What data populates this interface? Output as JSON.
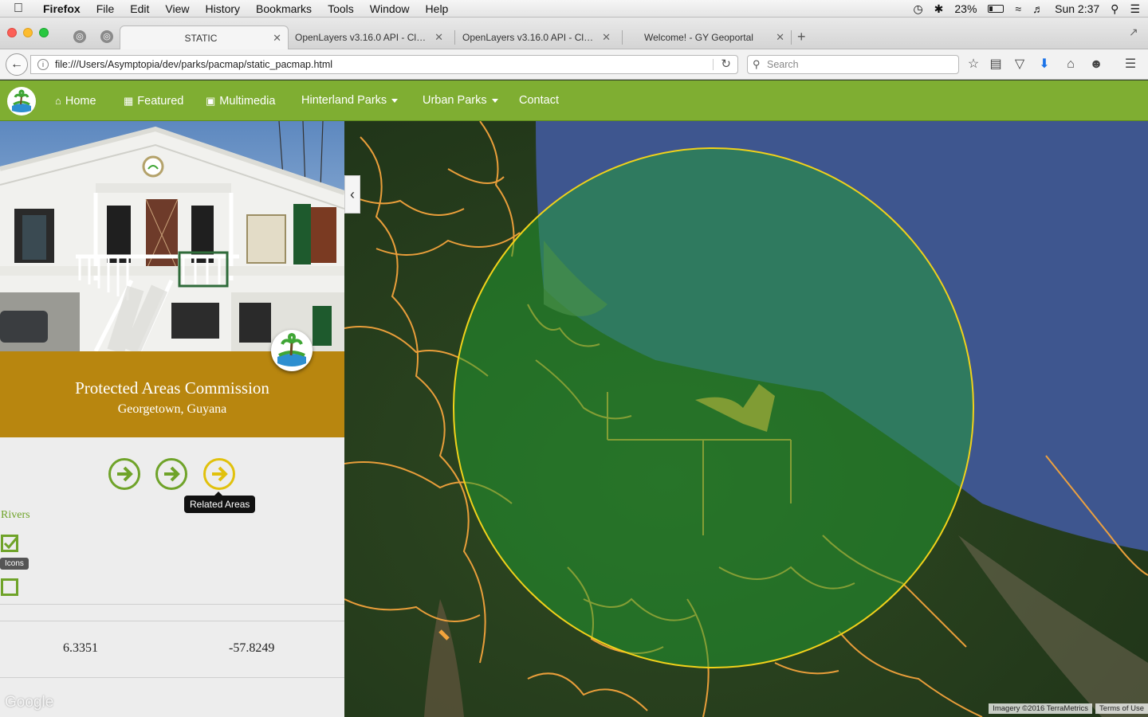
{
  "menubar": {
    "app": "Firefox",
    "items": [
      "File",
      "Edit",
      "View",
      "History",
      "Bookmarks",
      "Tools",
      "Window",
      "Help"
    ],
    "battery": "23%",
    "clock": "Sun 2:37"
  },
  "tabs": [
    {
      "label": "STATIC"
    },
    {
      "label": "OpenLayers v3.16.0 API - Clas..."
    },
    {
      "label": "OpenLayers v3.16.0 API - Clas..."
    },
    {
      "label": "Welcome! - GY Geoportal"
    }
  ],
  "urlbar": {
    "url": "file:///Users/Asymptopia/dev/parks/pacmap/static_pacmap.html"
  },
  "searchbar": {
    "placeholder": "Search"
  },
  "site_nav": {
    "home": "Home",
    "featured": "Featured",
    "multimedia": "Multimedia",
    "hinterland": "Hinterland Parks",
    "urban": "Urban Parks",
    "contact": "Contact"
  },
  "panel": {
    "title": "Protected Areas Commission",
    "subtitle": "Georgetown, Guyana",
    "tooltip": "Related Areas",
    "rivers_label": "Rivers",
    "icons_tooltip": "Icons",
    "rivers_checked": true,
    "icons_checked": false,
    "lat": "6.3351",
    "lon": "-57.8249"
  },
  "map": {
    "google_logo": "Google",
    "imagery": "Imagery ©2016 TerraMetrics",
    "terms": "Terms of Use",
    "accent_river": "#f4a43c",
    "accent_buffer": "#f1d21a"
  }
}
